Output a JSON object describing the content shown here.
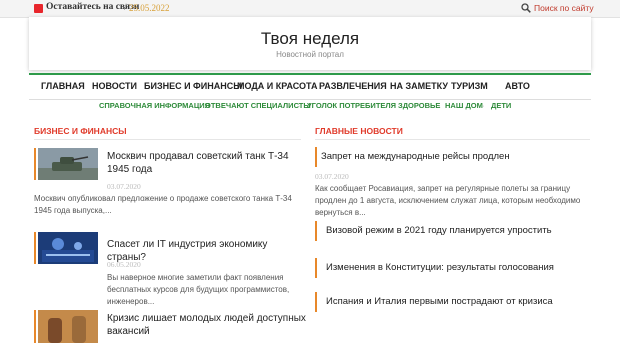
{
  "topbar": {
    "stay_label": "Оставайтесь на связи",
    "separator": "/",
    "date": "25.05.2022",
    "search_label": "Поиск по сайту"
  },
  "header": {
    "title": "Твоя неделя",
    "subtitle": "Новостной портал"
  },
  "main_nav": [
    "ГЛАВНАЯ",
    "НОВОСТИ",
    "БИЗНЕС И ФИНАНСЫ",
    "МОДА И КРАСОТА",
    "РАЗВЛЕЧЕНИЯ",
    "НА ЗАМЕТКУ",
    "ТУРИЗМ",
    "АВТО"
  ],
  "sub_nav": [
    "СПРАВОЧНАЯ ИНФОРМАЦИЯ",
    "ОТВЕЧАЮТ СПЕЦИАЛИСТЫ",
    "УГОЛОК ПОТРЕБИТЕЛЯ",
    "ЗДОРОВЬЕ",
    "НАШ ДОМ",
    "ДЕТИ"
  ],
  "left": {
    "section_title": "БИЗНЕС И ФИНАНСЫ",
    "articles": [
      {
        "title": "Москвич продавал советский танк Т-34 1945 года",
        "date": "03.07.2020",
        "text": "Москвич опубликовал предложение о продаже советского танка Т-34 1945 года выпуска,..."
      },
      {
        "title": "Спасет ли IT индустрия экономику страны?",
        "date": "06.05.2020",
        "text": "Вы наверное многие заметили факт появления бесплатных курсов для будущих программистов, инженеров..."
      },
      {
        "title": "Кризис лишает молодых людей доступных вакансий",
        "date": "",
        "text": ""
      }
    ]
  },
  "right": {
    "section_title": "ГЛАВНЫЕ НОВОСТИ",
    "lead": {
      "title": "Запрет на международные рейсы продлен",
      "date": "03.07.2020",
      "text": "Как сообщает Росавиация, запрет на регулярные полеты за границу продлен до 1 августа, исключением служат лица, которым необходимо вернуться в..."
    },
    "items": [
      "Визовой режим в 2021 году планируется упростить",
      "Изменения в Конституции: результаты голосования",
      "Испания и Италия первыми пострадают от кризиса"
    ]
  },
  "colors": {
    "accent_green": "#2e9a4a",
    "section_red": "#e03a2a",
    "bar_orange": "#e8882a",
    "date_gold": "#d8a038"
  },
  "icons": [
    "rss-icon",
    "search-icon"
  ]
}
